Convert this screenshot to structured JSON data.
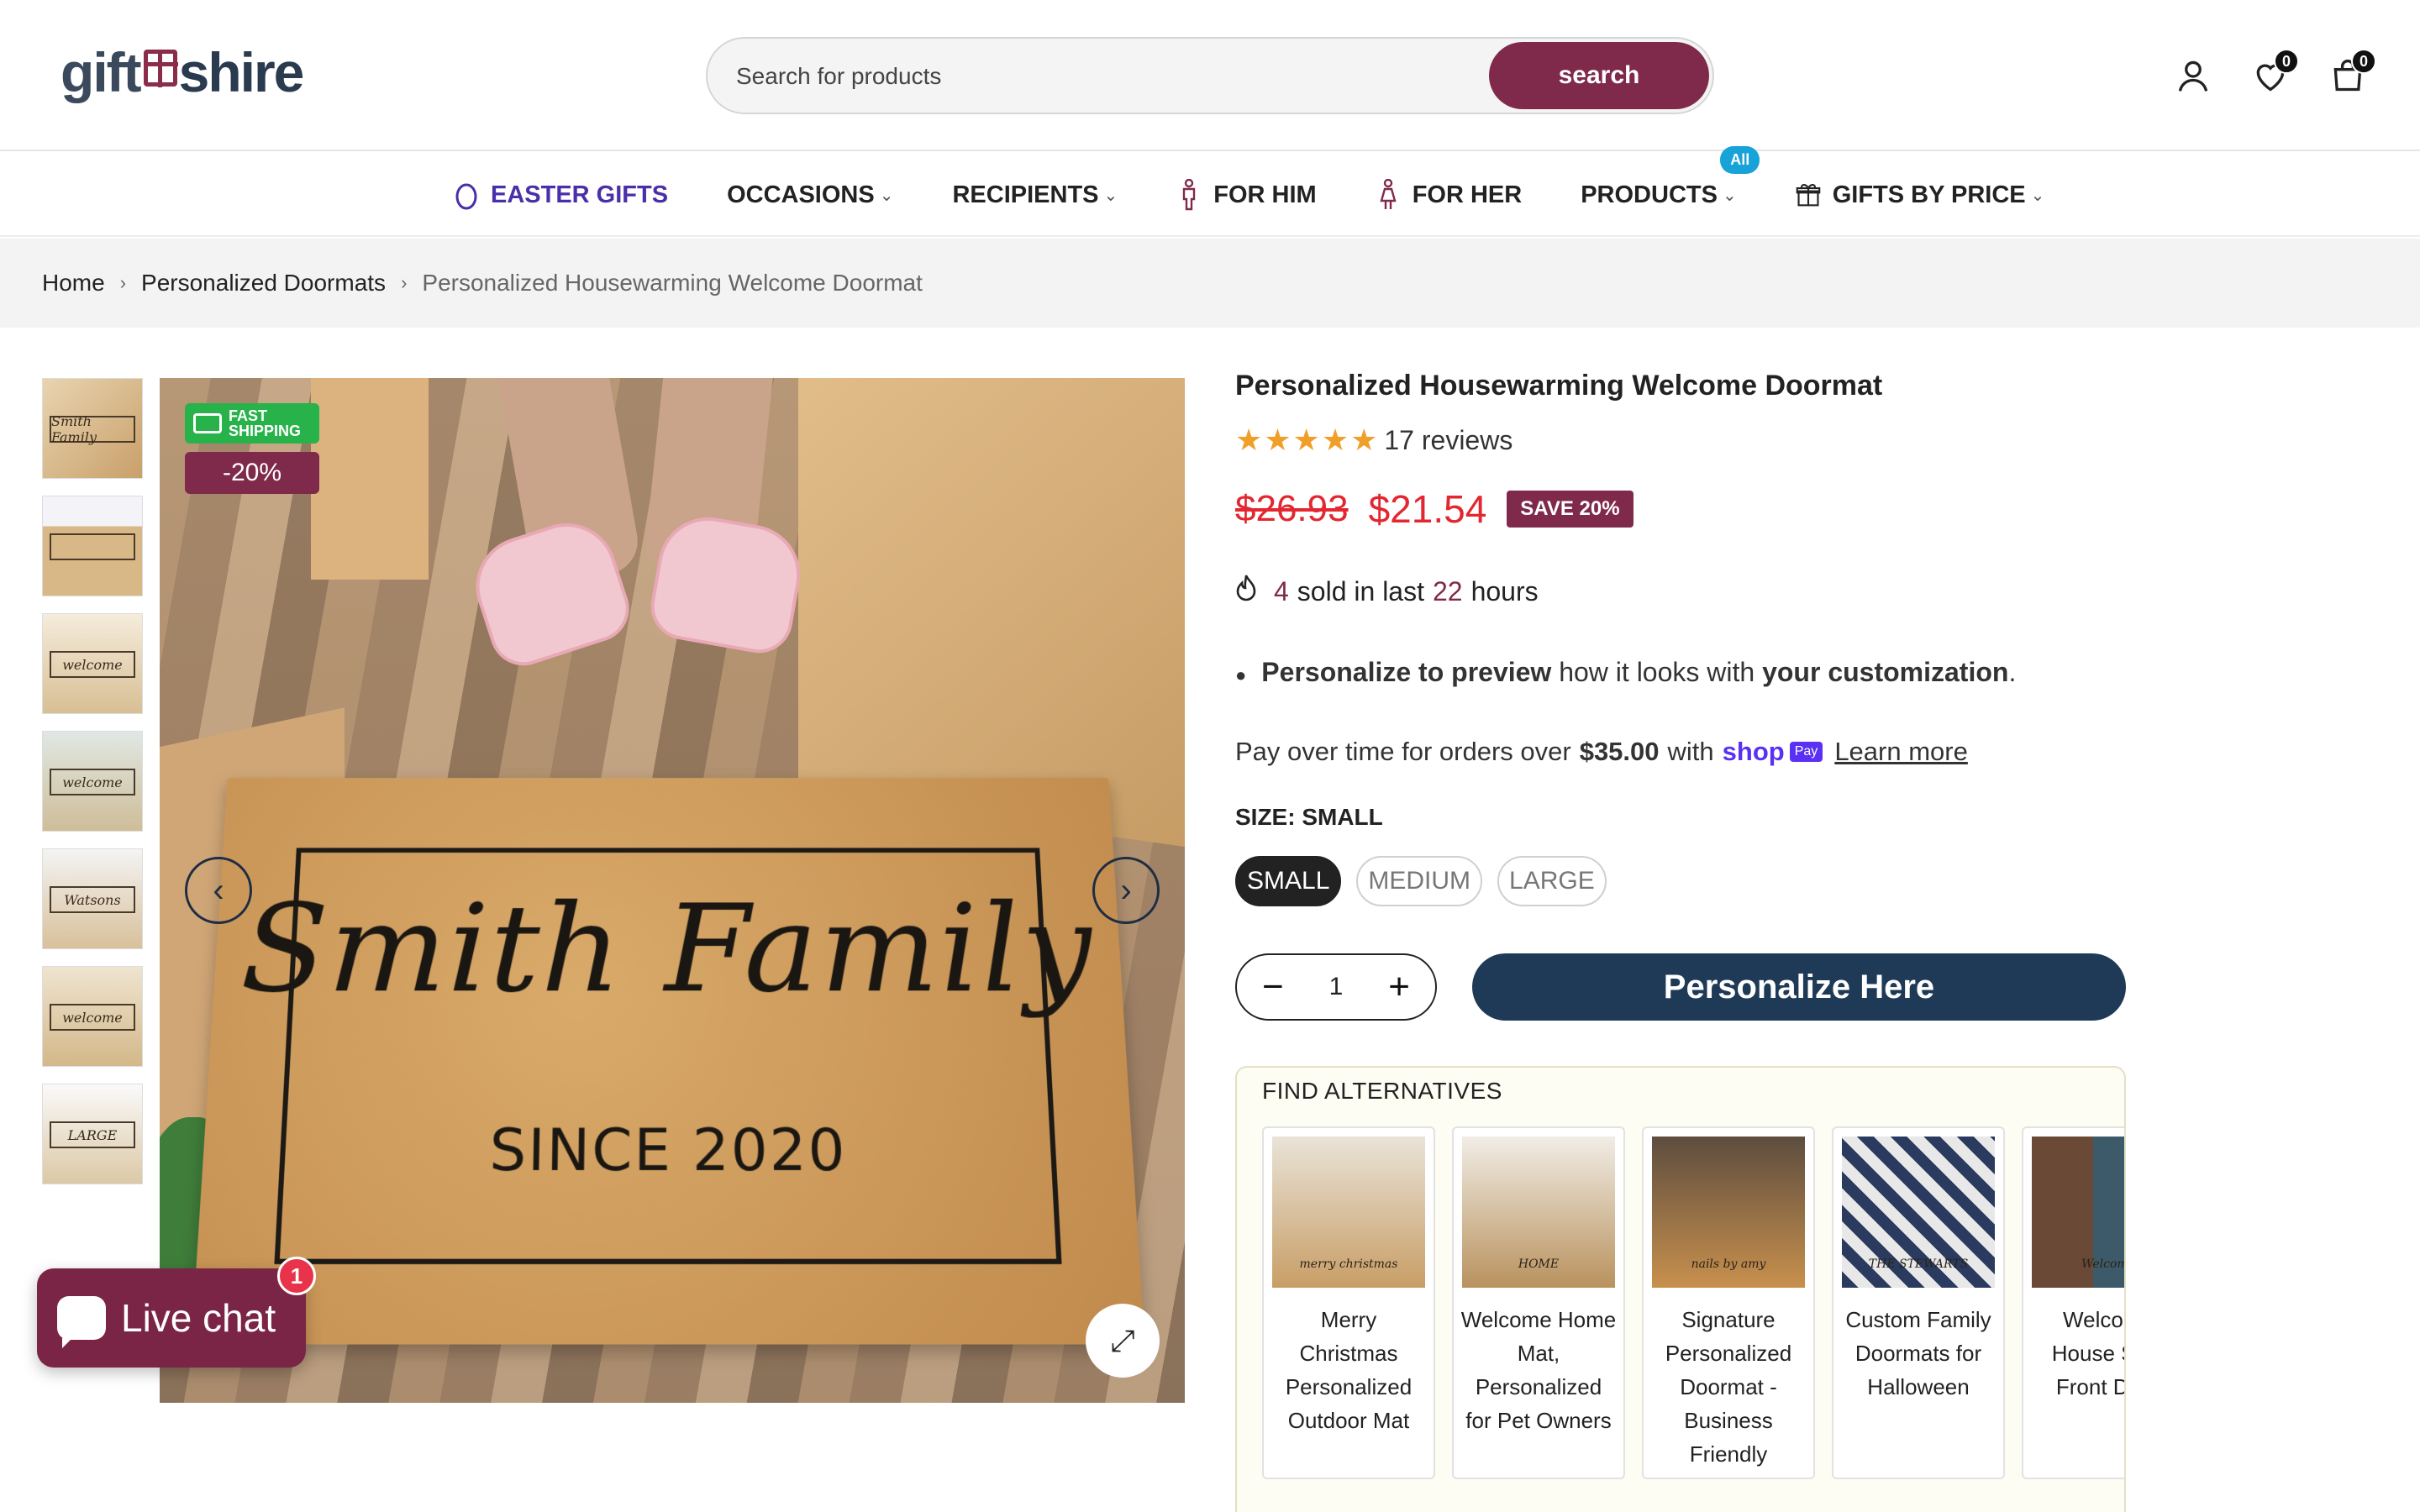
{
  "header": {
    "logo_left": "gift",
    "logo_right": "shire",
    "search_placeholder": "Search for products",
    "search_button": "search",
    "wishlist_count": "0",
    "cart_count": "0"
  },
  "nav": {
    "items": [
      {
        "label": "EASTER GIFTS"
      },
      {
        "label": "OCCASIONS"
      },
      {
        "label": "RECIPIENTS"
      },
      {
        "label": "FOR HIM"
      },
      {
        "label": "FOR HER"
      },
      {
        "label": "PRODUCTS"
      },
      {
        "label": "GIFTS BY PRICE"
      }
    ],
    "products_badge": "All"
  },
  "breadcrumb": {
    "home": "Home",
    "category": "Personalized Doormats",
    "current": "Personalized Housewarming Welcome Doormat"
  },
  "gallery": {
    "fast_shipping": [
      "FAST",
      "SHIPPING"
    ],
    "discount_badge": "-20%",
    "mat_name": "Smith Family",
    "mat_since": "SINCE 2020",
    "thumb_text": [
      "Smith Family",
      "",
      "welcome",
      "welcome",
      "Watsons",
      "welcome",
      "LARGE"
    ]
  },
  "product": {
    "title": "Personalized Housewarming Welcome Doormat",
    "stars": "★★★★★",
    "reviews": "17 reviews",
    "old_price": "$26.93",
    "new_price": "$21.54",
    "save_badge": "SAVE 20%",
    "sold_count": "4",
    "sold_mid": "sold in last",
    "sold_hours": "22",
    "sold_suffix": "hours",
    "bullet_b1": "Personalize to preview",
    "bullet_t1": "how it looks with",
    "bullet_b2": "your customization",
    "bullet_end": ".",
    "pay_prefix": "Pay over time for orders over",
    "pay_amount": "$35.00",
    "pay_with": "with",
    "shop_word": "shop",
    "pay_word": "Pay",
    "learn_more": "Learn more",
    "size_label": "SIZE: SMALL",
    "sizes": [
      "SMALL",
      "MEDIUM",
      "LARGE"
    ],
    "selected_size": "SMALL",
    "quantity": "1",
    "personalize_button": "Personalize Here"
  },
  "alternatives": {
    "title": "FIND ALTERNATIVES",
    "items": [
      {
        "name": "Merry Christmas Personalized Outdoor Mat",
        "img_text": "merry christmas"
      },
      {
        "name": "Welcome Home Mat, Personalized for Pet Owners",
        "img_text": "HOME"
      },
      {
        "name": "Signature Personalized Doormat - Business Friendly",
        "img_text": "nails by amy"
      },
      {
        "name": "Custom Family Doormats for Halloween",
        "img_text": "THE STEWARTS"
      },
      {
        "name": "Welcome House Sign Front Door",
        "img_text": "Welcome"
      }
    ]
  },
  "live_chat": {
    "label": "Live chat",
    "badge": "1"
  },
  "colors": {
    "brand": "#7f2a4a",
    "primary_button": "#1f3a57",
    "price_red": "#e3262f",
    "easter_purple": "#4b2fa8",
    "fast_shipping_green": "#27b24a",
    "star_orange": "#f0a028"
  }
}
